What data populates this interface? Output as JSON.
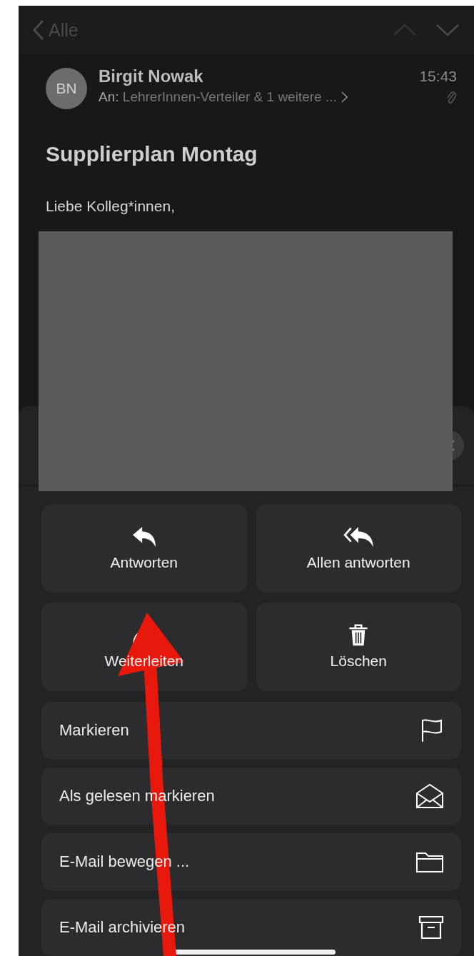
{
  "nav": {
    "back_label": "Alle"
  },
  "message": {
    "avatar_initials": "BN",
    "sender": "Birgit Nowak",
    "time": "15:43",
    "to_label": "An:",
    "recipients": "LehrerInnen-Verteiler & 1 weitere ...",
    "subject": "Supplierplan Montag",
    "greeting": "Liebe Kolleg*innen,"
  },
  "actions": [
    {
      "kind": "reply",
      "label": "Antworten"
    },
    {
      "kind": "reply_all",
      "label": "Allen antworten"
    },
    {
      "kind": "forward",
      "label": "Weiterleiten"
    },
    {
      "kind": "delete",
      "label": "Löschen"
    }
  ],
  "menu": [
    {
      "kind": "flag",
      "label": "Markieren"
    },
    {
      "kind": "read",
      "label": "Als gelesen markieren"
    },
    {
      "kind": "move",
      "label": "E-Mail bewegen ..."
    },
    {
      "kind": "archive",
      "label": "E-Mail archivieren"
    }
  ]
}
